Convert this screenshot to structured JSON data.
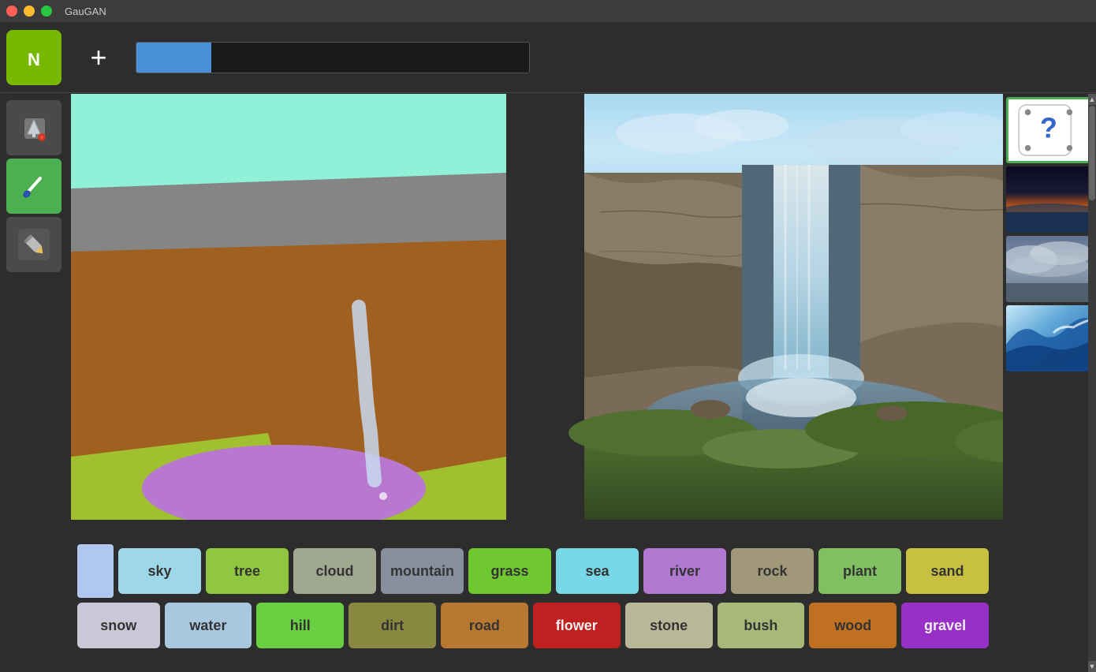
{
  "titlebar": {
    "title": "GauGAN"
  },
  "toolbar": {
    "plus_label": "+",
    "progress_label": ""
  },
  "tools": [
    {
      "id": "fill",
      "icon": "🪣",
      "active": false
    },
    {
      "id": "brush",
      "icon": "🖌️",
      "active": true
    },
    {
      "id": "pencil",
      "icon": "✏️",
      "active": false
    }
  ],
  "palette_row1": [
    {
      "label": "",
      "color": "#b0c8f0",
      "text_color": "#333"
    },
    {
      "label": "sky",
      "color": "#9ed8e8",
      "text_color": "#333"
    },
    {
      "label": "tree",
      "color": "#8fc840",
      "text_color": "#333"
    },
    {
      "label": "cloud",
      "color": "#a0a890",
      "text_color": "#333"
    },
    {
      "label": "mountain",
      "color": "#8890a0",
      "text_color": "#333"
    },
    {
      "label": "grass",
      "color": "#70c830",
      "text_color": "#333"
    },
    {
      "label": "sea",
      "color": "#78d8e8",
      "text_color": "#333"
    },
    {
      "label": "river",
      "color": "#b078d0",
      "text_color": "#333"
    },
    {
      "label": "rock",
      "color": "#a09878",
      "text_color": "#333"
    },
    {
      "label": "plant",
      "color": "#80c060",
      "text_color": "#333"
    },
    {
      "label": "sand",
      "color": "#c8c040",
      "text_color": "#333"
    }
  ],
  "palette_row2": [
    {
      "label": "snow",
      "color": "#c8c8d8",
      "text_color": "#333"
    },
    {
      "label": "water",
      "color": "#a8c8e0",
      "text_color": "#333"
    },
    {
      "label": "hill",
      "color": "#68d040",
      "text_color": "#333"
    },
    {
      "label": "dirt",
      "color": "#888840",
      "text_color": "#333"
    },
    {
      "label": "road",
      "color": "#b87830",
      "text_color": "#333"
    },
    {
      "label": "flower",
      "color": "#c02020",
      "text_color": "#eee"
    },
    {
      "label": "stone",
      "color": "#b8b898",
      "text_color": "#333"
    },
    {
      "label": "bush",
      "color": "#a8b878",
      "text_color": "#333"
    },
    {
      "label": "wood",
      "color": "#c07020",
      "text_color": "#333"
    },
    {
      "label": "gravel",
      "color": "#9830c8",
      "text_color": "#eee"
    }
  ],
  "thumbnails": [
    {
      "id": "dice",
      "type": "dice",
      "selected": true
    },
    {
      "id": "sunset",
      "type": "sunset",
      "selected": false
    },
    {
      "id": "cloud",
      "type": "cloud",
      "selected": false
    },
    {
      "id": "wave",
      "type": "wave",
      "selected": false
    }
  ],
  "drawing": {
    "sky_color": "#a0f0e0",
    "mountain_color": "#808080",
    "dirt_color": "#a06020",
    "grass_color": "#a0c030",
    "water_color": "#b878d0",
    "waterfall_color": "#c8d8e8"
  }
}
